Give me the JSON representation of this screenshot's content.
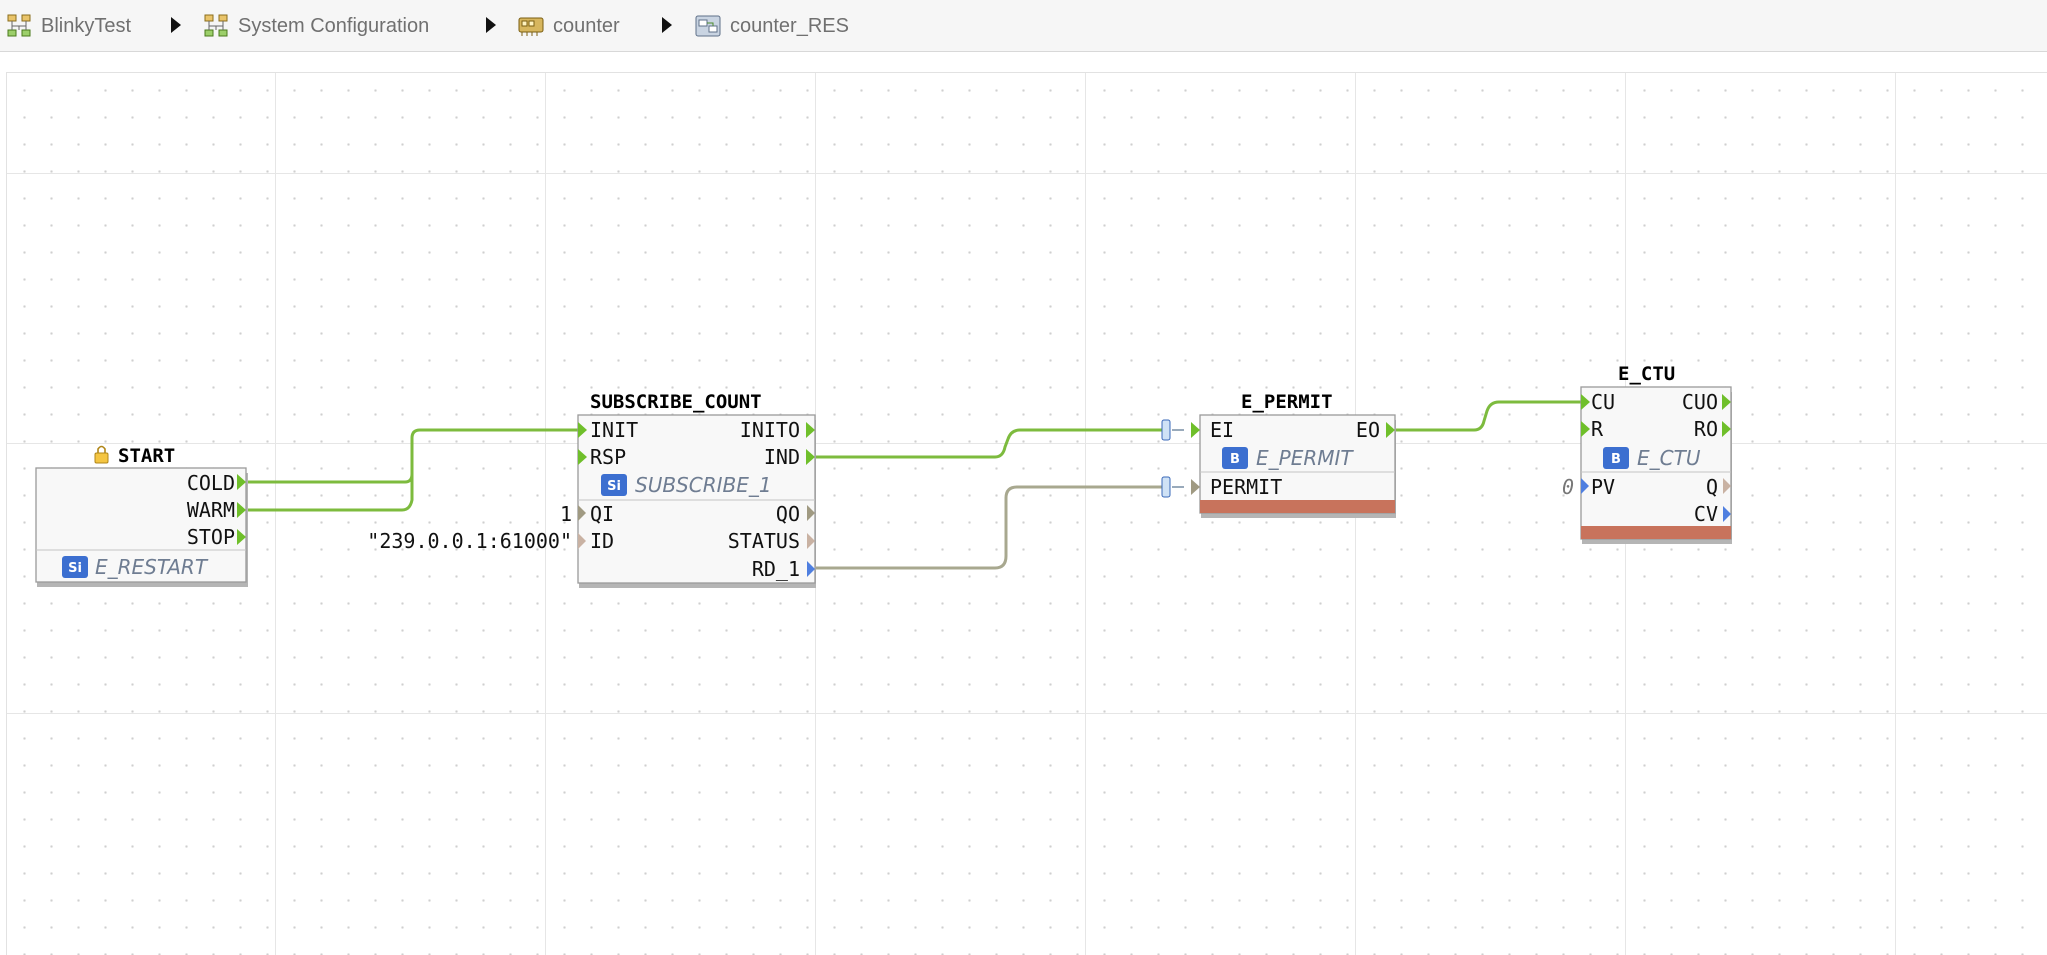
{
  "breadcrumb": [
    {
      "label": "BlinkyTest",
      "icon": "system-tree-icon"
    },
    {
      "label": "System Configuration",
      "icon": "system-tree-icon"
    },
    {
      "label": "counter",
      "icon": "device-icon"
    },
    {
      "label": "counter_RES",
      "icon": "resource-icon"
    }
  ],
  "blocks": {
    "start": {
      "name": "START",
      "type": "E_RESTART",
      "badge": "Si",
      "outputs": [
        "COLD",
        "WARM",
        "STOP"
      ]
    },
    "subscribe": {
      "name": "SUBSCRIBE_COUNT",
      "type": "SUBSCRIBE_1",
      "badge": "Si",
      "event_in": [
        "INIT",
        "RSP"
      ],
      "event_out": [
        "INITO",
        "IND"
      ],
      "data_in": [
        "QI",
        "ID"
      ],
      "data_out": [
        "QO",
        "STATUS",
        "RD_1"
      ]
    },
    "permit": {
      "name": "E_PERMIT",
      "type": "E_PERMIT",
      "badge": "B",
      "event_in": [
        "EI"
      ],
      "event_out": [
        "EO"
      ],
      "data_in": [
        "PERMIT"
      ]
    },
    "ctu": {
      "name": "E_CTU",
      "type": "E_CTU",
      "badge": "B",
      "event_in": [
        "CU",
        "R"
      ],
      "event_out": [
        "CUO",
        "RO"
      ],
      "data_in": [
        "PV"
      ],
      "data_out": [
        "Q",
        "CV"
      ]
    }
  },
  "parameters": {
    "subscribe_qi": "1",
    "subscribe_id": "\"239.0.0.1:61000\"",
    "ctu_pv": "0"
  },
  "colors": {
    "event_wire": "#7dbb3e",
    "data_wire": "#a8a88f",
    "error_bar": "#c8735c",
    "type_badge": "#3c6fd0"
  }
}
